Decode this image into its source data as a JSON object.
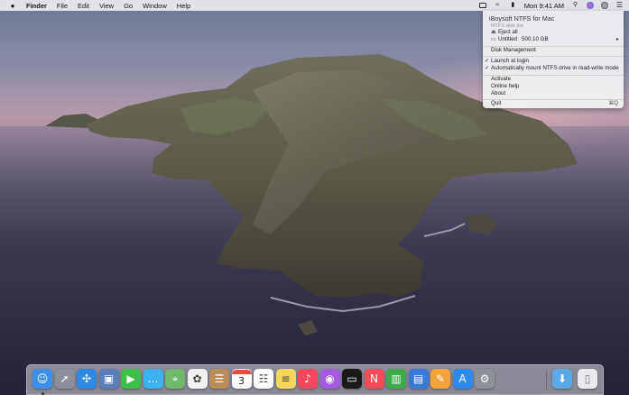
{
  "menubar": {
    "app_name": "Finder",
    "items": [
      "File",
      "Edit",
      "View",
      "Go",
      "Window",
      "Help"
    ],
    "clock": "Mon 9:41 AM",
    "status_icons": [
      "iboysoft-drive-icon",
      "wifi-icon",
      "battery-icon",
      "search-icon",
      "siri-icon",
      "user-avatar-icon",
      "control-list-icon"
    ]
  },
  "dropdown": {
    "title": "iBoysoft NTFS for Mac",
    "section_label": "NTFS disk list",
    "eject_all": "Eject all",
    "drive_name": "Untitled",
    "drive_size": "500.10 GB",
    "disk_management": "Disk Management",
    "launch_at_login": "Launch at login",
    "auto_mount": "Automatically mount NTFS drive in read-write mode",
    "activate": "Activate",
    "online_help": "Online help",
    "about": "About",
    "quit": "Quit",
    "quit_shortcut": "⌘Q"
  },
  "dock": {
    "apps": [
      {
        "name": "Finder",
        "icon": "finder-icon",
        "color": "#3d8fe8",
        "running": true
      },
      {
        "name": "Launchpad",
        "icon": "rocket-icon",
        "color": "#8a8f99",
        "running": false
      },
      {
        "name": "Safari",
        "icon": "compass-icon",
        "color": "#2f87e6",
        "running": false
      },
      {
        "name": "Preview",
        "icon": "photo-viewer-icon",
        "color": "#5a7fb8",
        "running": false
      },
      {
        "name": "FaceTime",
        "icon": "video-camera-icon",
        "color": "#3fbf4a",
        "running": false
      },
      {
        "name": "Messages",
        "icon": "speech-bubble-icon",
        "color": "#3cb3f0",
        "running": false
      },
      {
        "name": "Maps",
        "icon": "map-icon",
        "color": "#6fb86c",
        "running": false
      },
      {
        "name": "Photos",
        "icon": "flower-icon",
        "color": "#f2f2f2",
        "running": false
      },
      {
        "name": "Contacts",
        "icon": "address-book-icon",
        "color": "#b98c5a",
        "running": false
      },
      {
        "name": "Calendar",
        "icon": "calendar-icon",
        "color": "#ffffff",
        "running": false
      },
      {
        "name": "Reminders",
        "icon": "checklist-icon",
        "color": "#ffffff",
        "running": false
      },
      {
        "name": "Notes",
        "icon": "notepad-icon",
        "color": "#f6d65a",
        "running": false
      },
      {
        "name": "Music",
        "icon": "music-note-icon",
        "color": "#f5475c",
        "running": false
      },
      {
        "name": "Podcasts",
        "icon": "podcast-icon",
        "color": "#a45be0",
        "running": false
      },
      {
        "name": "TV",
        "icon": "tv-icon",
        "color": "#1a1a1a",
        "running": false
      },
      {
        "name": "News",
        "icon": "news-icon",
        "color": "#f24b5a",
        "running": false
      },
      {
        "name": "Numbers",
        "icon": "bar-chart-icon",
        "color": "#3ea84a",
        "running": false
      },
      {
        "name": "Keynote",
        "icon": "presentation-icon",
        "color": "#3b79d8",
        "running": false
      },
      {
        "name": "Pages",
        "icon": "pen-document-icon",
        "color": "#f2a33a",
        "running": false
      },
      {
        "name": "App Store",
        "icon": "app-store-icon",
        "color": "#2e8af0",
        "running": false
      },
      {
        "name": "System Preferences",
        "icon": "gear-icon",
        "color": "#8e9198",
        "running": false
      }
    ],
    "calendar_day": "3",
    "trailing": [
      {
        "name": "Downloads",
        "icon": "downloads-folder-icon",
        "color": "#5aa9e6"
      },
      {
        "name": "Trash",
        "icon": "trash-icon",
        "color": "#e8eaee"
      }
    ]
  }
}
